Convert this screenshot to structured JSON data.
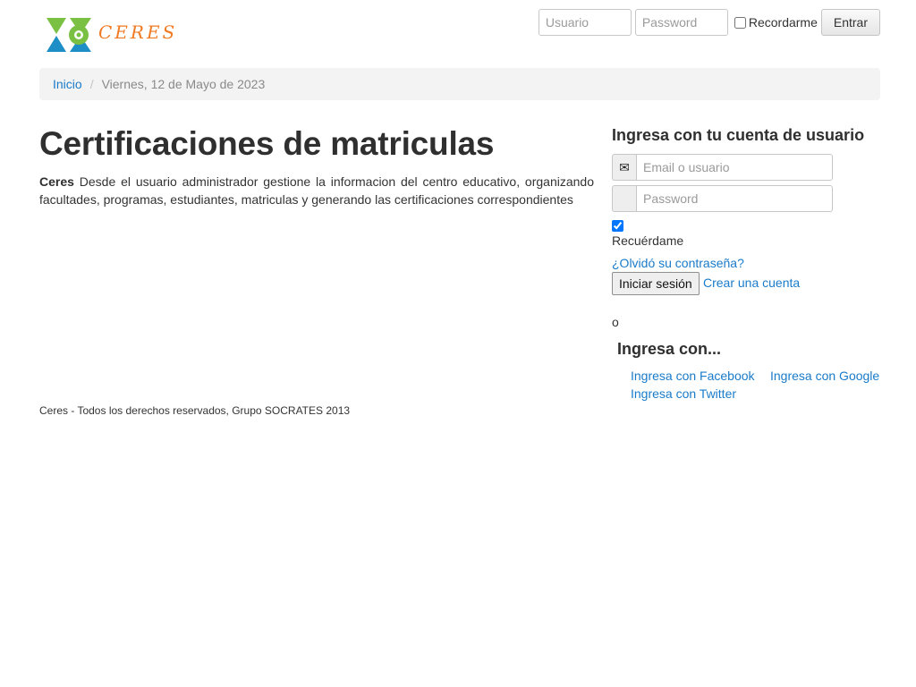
{
  "header": {
    "logo_text": "CERES",
    "username_placeholder": "Usuario",
    "password_placeholder": "Password",
    "remember_label": "Recordarme",
    "remember_checked": false,
    "submit_label": "Entrar"
  },
  "breadcrumb": {
    "home_label": "Inicio",
    "separator": "/",
    "date": "Viernes, 12 de Mayo de 2023"
  },
  "main": {
    "title": "Certificaciones de matriculas",
    "brand": "Ceres",
    "description": " Desde el usuario administrador gestione la informacion del centro educativo, organizando facultades, programas, estudiantes, matriculas y generando las certificaciones correspondientes"
  },
  "login": {
    "title": "Ingresa con tu cuenta de usuario",
    "email_placeholder": "Email o usuario",
    "password_placeholder": "Password",
    "email_icon": "envelope-icon",
    "remember_label": "Recuérdame",
    "remember_checked": true,
    "forgot_link": "¿Olvidó su contraseña?",
    "submit_label": "Iniciar sesión",
    "create_link": "Crear una cuenta",
    "or_text": "o",
    "social_title": "Ingresa con...",
    "facebook_link": "Ingresa con Facebook",
    "google_link": "Ingresa con Google",
    "twitter_link": "Ingresa con Twitter"
  },
  "footer": {
    "text": "Ceres - Todos los derechos reservados, Grupo SOCRATES 2013"
  },
  "colors": {
    "link": "#1a7bc9",
    "logo_orange": "#f07a22",
    "logo_green": "#7ac143",
    "logo_blue": "#1e8fc6"
  }
}
